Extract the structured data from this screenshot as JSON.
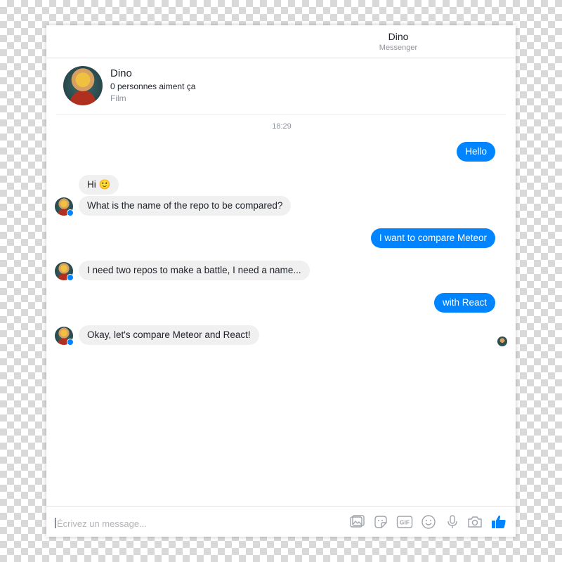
{
  "header": {
    "title": "Dino",
    "subtitle": "Messenger"
  },
  "profile": {
    "name": "Dino",
    "likes": "0 personnes aiment ça",
    "category": "Film"
  },
  "timestamp": "18:29",
  "messages": [
    {
      "from": "me",
      "text": "Hello"
    },
    {
      "from": "bot",
      "text": "Hi 🙂"
    },
    {
      "from": "bot",
      "text": "What is the name of the repo to be compared?"
    },
    {
      "from": "me",
      "text": "I want to compare Meteor"
    },
    {
      "from": "bot",
      "text": "I need two repos to make a battle, I need a name..."
    },
    {
      "from": "me",
      "text": "with React"
    },
    {
      "from": "bot",
      "text": "Okay, let's compare Meteor and React!"
    }
  ],
  "composer": {
    "placeholder": "Écrivez un message...",
    "icons": [
      "image-icon",
      "sticker-icon",
      "gif-icon",
      "emoji-icon",
      "microphone-icon",
      "camera-icon",
      "thumbs-up-icon"
    ]
  },
  "colors": {
    "accent": "#0084ff",
    "incoming_bubble": "#f1f0f0",
    "muted_text": "#90949c"
  }
}
